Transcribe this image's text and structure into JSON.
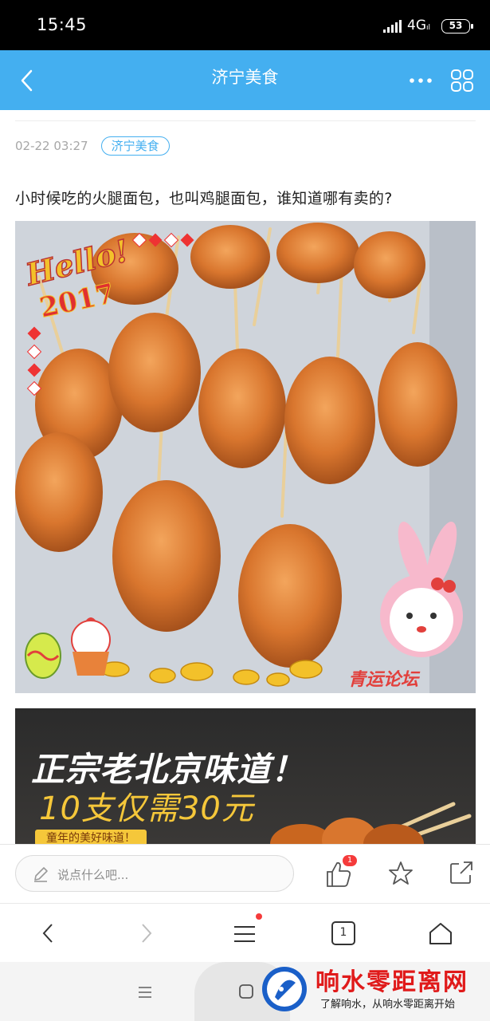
{
  "status_bar": {
    "time": "15:45",
    "network": "4G",
    "network_sub": "ıl",
    "battery": "53"
  },
  "header": {
    "title": "济宁美食",
    "back_icon": "chevron-left-icon",
    "more_icon": "more-dots-icon",
    "menu_icon": "grid-icon"
  },
  "post": {
    "date": "02-22 03:27",
    "tag": "济宁美食",
    "title": "小时候吃的火腿面包，也叫鸡腿面包，谁知道哪有卖的?",
    "image1": {
      "sticker_hello": "Hello!",
      "sticker_year": "2017",
      "corner_text": "青运论坛"
    },
    "image2": {
      "line1": "正宗老北京味道！",
      "line2": "10支仅需30元",
      "line3": "童年的美好味道！"
    }
  },
  "comment_bar": {
    "placeholder": "说点什么吧...",
    "like_count": "1",
    "icons": [
      "pen-icon",
      "thumb-up-icon",
      "star-icon",
      "share-icon"
    ]
  },
  "browser_bar": {
    "tab_count": "1",
    "icons": [
      "back-arrow-icon",
      "forward-arrow-icon",
      "menu-icon",
      "tabs-icon",
      "home-icon"
    ]
  },
  "watermark": {
    "title": "响水零距离网",
    "subtitle": "了解响水，从响水零距离开始"
  },
  "colors": {
    "header_blue": "#44aff0",
    "badge_red": "#f53b3b",
    "watermark_red": "#e01a1a"
  }
}
